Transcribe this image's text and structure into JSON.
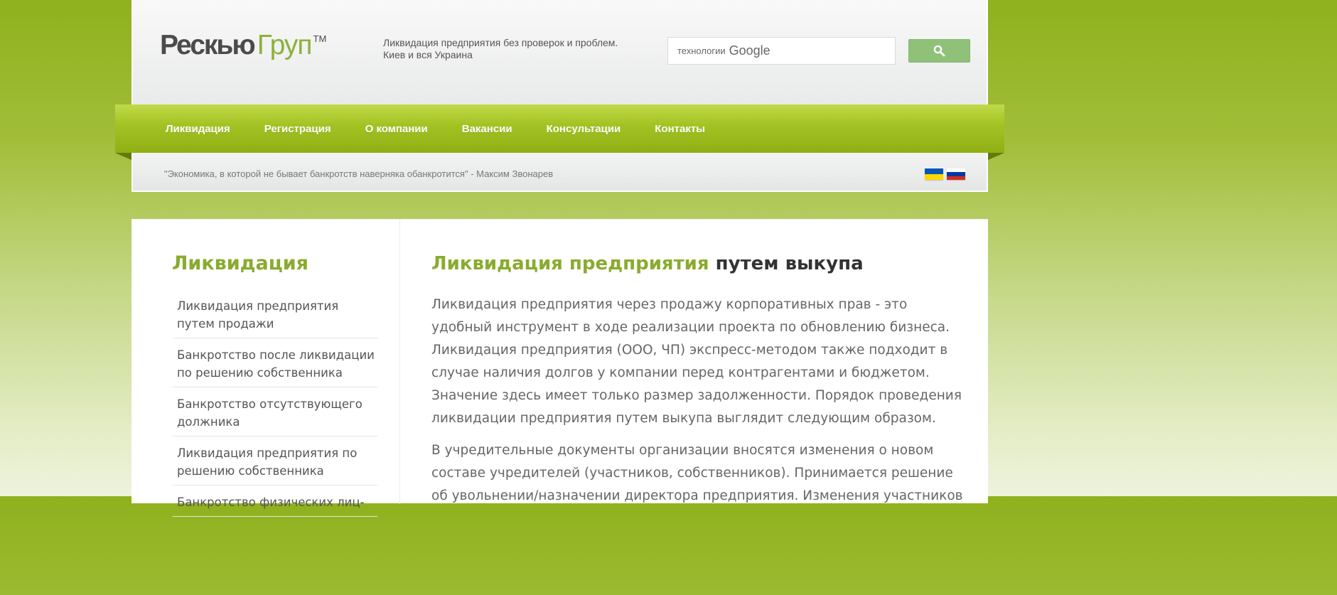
{
  "header": {
    "logo": {
      "part1": "Рескью",
      "part2": "Груп",
      "tm": "TM"
    },
    "tagline": [
      "Ликвидация предприятия без проверок и проблем.",
      "Киев и вся Украина"
    ],
    "search": {
      "tech_label": "технологии",
      "brand_label": "Google"
    }
  },
  "nav": {
    "items": [
      {
        "label": "Ликвидация"
      },
      {
        "label": "Регистрация"
      },
      {
        "label": "О компании"
      },
      {
        "label": "Вакансии"
      },
      {
        "label": "Консультации"
      },
      {
        "label": "Контакты"
      }
    ]
  },
  "quote": {
    "text": "\"Экономика, в которой не бывает банкротств наверняка обанкротится\" - Максим Звонарев"
  },
  "languages": [
    {
      "name": "ukrainian-flag",
      "colors": [
        "#0057b7",
        "#ffd700"
      ]
    },
    {
      "name": "russian-flag",
      "colors": [
        "#ffffff",
        "#0039a6",
        "#d52b1e"
      ]
    }
  ],
  "sidebar": {
    "title": "Ликвидация",
    "items": [
      {
        "label": "Ликвидация предприятия путем продажи"
      },
      {
        "label": "Банкротство после ликвидации по решению собственника"
      },
      {
        "label": "Банкротство отсутствующего должника"
      },
      {
        "label": "Ликвидация предприятия по решению собственника"
      },
      {
        "label": "Банкротство физических лиц-"
      }
    ]
  },
  "main": {
    "title_green": "Ликвидация предприятия",
    "title_dark": "путем выкупа",
    "paragraphs": [
      "Ликвидация предприятия через продажу корпоративных прав - это удобный инструмент в ходе реализации проекта по обновлению бизнеса. Ликвидация предприятия (ООО, ЧП) экспресс-методом также подходит в случае наличия долгов у компании перед контрагентами и бюджетом. Значение здесь имеет только размер задолженности. Порядок проведения ликвидации предприятия путем выкупа выглядит следующим образом.",
      "В учредительные документы организации вносятся изменения о новом составе учредителей (участников, собственников). Принимается решение об увольнении/назначении директора предприятия. Изменения участников"
    ]
  },
  "colors": {
    "brand_green": "#8aab2e",
    "nav_green": "#a4c424",
    "search_button": "#8fc178"
  }
}
